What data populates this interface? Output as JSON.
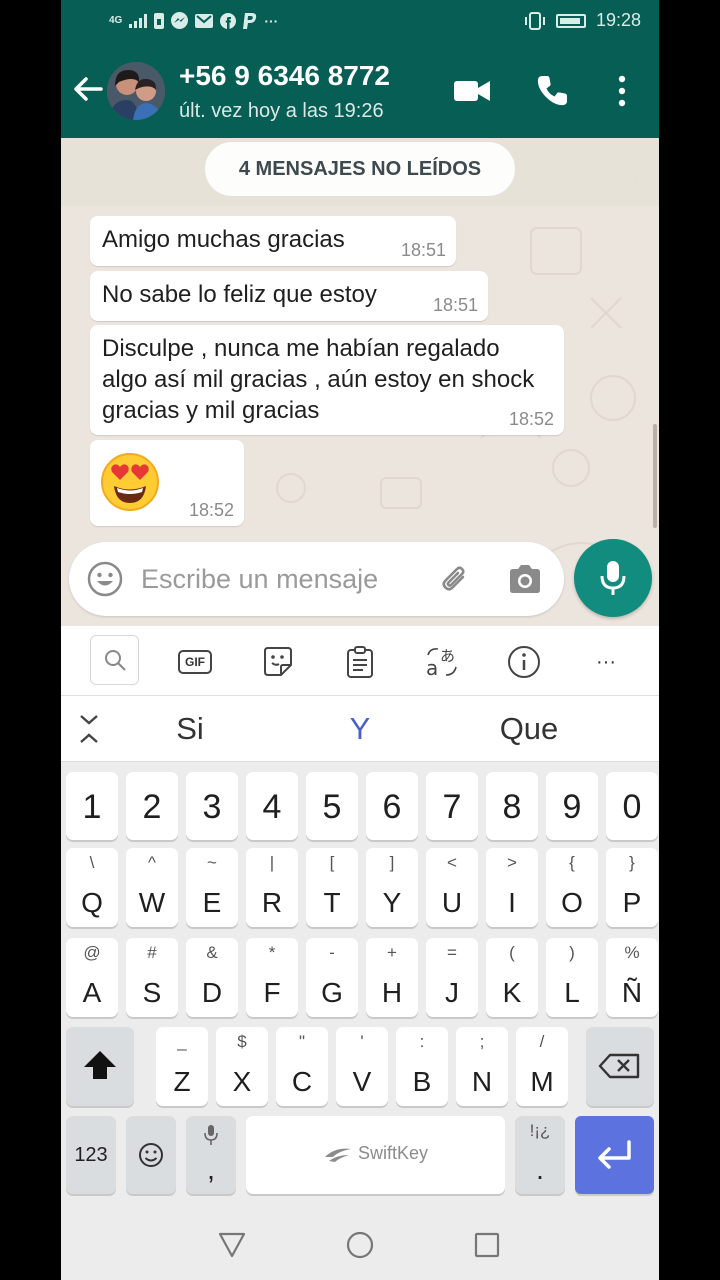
{
  "status_bar": {
    "time": "19:28",
    "network": "4G",
    "icons": [
      "signal-icon",
      "sim-icon",
      "messenger-icon",
      "gmail-icon",
      "facebook-icon",
      "paypal-icon",
      "more-notifications-icon"
    ],
    "more_indicator": "···",
    "right_icons": [
      "vibrate-icon",
      "battery-icon"
    ]
  },
  "header": {
    "contact_name": "+56 9 6346 8772",
    "last_seen": "últ. vez hoy a las 19:26"
  },
  "chat": {
    "unread_label": "4 MENSAJES NO LEÍDOS",
    "messages": [
      {
        "text": "Amigo muchas gracias",
        "time": "18:51"
      },
      {
        "text": "No sabe lo feliz que estoy",
        "time": "18:51"
      },
      {
        "text": "Disculpe , nunca me habían regalado algo así mil gracias , aún estoy en shock gracias y mil gracias",
        "time": "18:52"
      },
      {
        "text": "😍",
        "time": "18:52",
        "emoji_name": "heart-eyes-emoji"
      }
    ]
  },
  "composer": {
    "placeholder": "Escribe un mensaje"
  },
  "keyboard": {
    "brand": "SwiftKey",
    "toolbar": [
      "search-icon",
      "gif-icon",
      "sticker-icon",
      "clipboard-icon",
      "translate-icon",
      "info-icon",
      "more-icon"
    ],
    "gif_label": "GIF",
    "more_label": "···",
    "suggestions": [
      "Si",
      "Y",
      "Que"
    ],
    "number_row": [
      "1",
      "2",
      "3",
      "4",
      "5",
      "6",
      "7",
      "8",
      "9",
      "0"
    ],
    "row1": {
      "keys": [
        "Q",
        "W",
        "E",
        "R",
        "T",
        "Y",
        "U",
        "I",
        "O",
        "P"
      ],
      "subs": [
        "\\",
        "^",
        "~",
        "|",
        "[",
        "]",
        "<",
        ">",
        "{",
        "}"
      ]
    },
    "row2": {
      "keys": [
        "A",
        "S",
        "D",
        "F",
        "G",
        "H",
        "J",
        "K",
        "L",
        "Ñ"
      ],
      "subs": [
        "@",
        "#",
        "&",
        "*",
        "-",
        "+",
        "=",
        "(",
        ")",
        "%"
      ]
    },
    "row3": {
      "keys": [
        "Z",
        "X",
        "C",
        "V",
        "B",
        "N",
        "M"
      ],
      "subs": [
        "_",
        "$",
        "\"",
        "'",
        ":",
        ";",
        "/"
      ]
    },
    "numbers_key": "123",
    "comma_key": ",",
    "period_key": ".",
    "period_sub": "!¡¿",
    "accent_color": "#5c73df"
  },
  "colors": {
    "header": "#075e54",
    "accent": "#128c7e",
    "chat_background": "#ece5dd",
    "bubble": "#ffffff"
  }
}
